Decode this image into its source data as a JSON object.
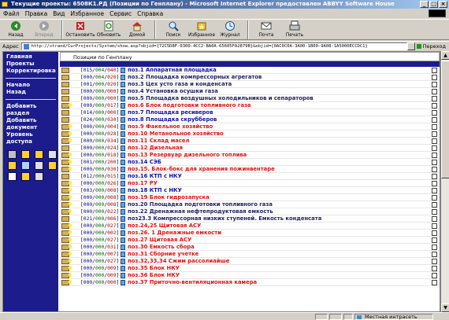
{
  "window": {
    "title": "Текущие проекты: 6508К1.РД (Позиции по Генплану) - Microsoft Internet Explorer предоставлен ABBYY Software House",
    "buttons": [
      "_",
      "□",
      "×"
    ]
  },
  "menu": [
    "Файл",
    "Правка",
    "Вид",
    "Избранное",
    "Сервис",
    "Справка"
  ],
  "toolbar": [
    {
      "label": "Назад",
      "icon": "back-arrow-icon",
      "disabled": false
    },
    {
      "label": "Вперед",
      "icon": "forward-arrow-icon",
      "disabled": true
    },
    {
      "label": "Остановить",
      "icon": "stop-icon",
      "disabled": false
    },
    {
      "label": "Обновить",
      "icon": "refresh-icon",
      "disabled": false
    },
    {
      "label": "Домой",
      "icon": "home-icon",
      "disabled": false
    },
    {
      "label": "Поиск",
      "icon": "search-icon",
      "disabled": false
    },
    {
      "label": "Избранное",
      "icon": "favorites-icon",
      "disabled": false
    },
    {
      "label": "Журнал",
      "icon": "history-icon",
      "disabled": false
    },
    {
      "label": "Почта",
      "icon": "mail-icon",
      "disabled": false
    },
    {
      "label": "Печать",
      "icon": "print-icon",
      "disabled": false
    }
  ],
  "address": {
    "label": "Адрес",
    "url": "http://strand/CurProjects/System/show.asp?objid={72C5D8F-0300-4CC2-BA0A-65605FA2879B}&objid={0AC0C0A-3A00-1B00-9A08-1A5000ECCDC1}",
    "go_label": "Переход"
  },
  "sidebar": {
    "links_top": [
      "Главная",
      "Проекты",
      "Корректировка"
    ],
    "links_mid": [
      "Начало",
      "Назад"
    ],
    "links_bottom": [
      "Добавить раздел",
      "Добавить документ",
      "Уровень доступа"
    ]
  },
  "crumb": "Позиции по Генплану",
  "rows": [
    {
      "code": [
        "015",
        "004",
        "040"
      ],
      "name": "поз.1 Аппаратная площадка",
      "color": "blue",
      "bulb": false
    },
    {
      "code": [
        "000",
        "004",
        "020"
      ],
      "name": "поз.2 Площадка компрессорных агрегатов",
      "color": "dark",
      "bulb": false
    },
    {
      "code": [
        "001",
        "000",
        "020"
      ],
      "name": "поз.3 Цех усто газа и конденсата",
      "color": "dark",
      "bulb": false
    },
    {
      "code": [
        "000",
        "000",
        "000"
      ],
      "name": "поз.4 Установка осушки газа",
      "color": "dark",
      "bulb": false
    },
    {
      "code": [
        "000",
        "000",
        "000"
      ],
      "name": "поз.5 Площадка воздушных холодильников и сепараторов",
      "color": "dark",
      "bulb": false
    },
    {
      "code": [
        "000",
        "000",
        "017"
      ],
      "name": "поз.6 Блок подготовки топливного газа",
      "color": "red",
      "bulb": true
    },
    {
      "code": [
        "014",
        "000",
        "000"
      ],
      "name": "поз.7 Площадка ресиверов",
      "color": "blue",
      "bulb": false
    },
    {
      "code": [
        "024",
        "000",
        "030"
      ],
      "name": "поз.8 Площадка скрубберов",
      "color": "blue",
      "bulb": false
    },
    {
      "code": [
        "000",
        "000",
        "004"
      ],
      "name": "поз.9 Факельное хозяйство",
      "color": "red",
      "bulb": true
    },
    {
      "code": [
        "000",
        "000",
        "028"
      ],
      "name": "поз.10 Метанольное хозяйство",
      "color": "red",
      "bulb": true
    },
    {
      "code": [
        "000",
        "000",
        "034"
      ],
      "name": "поз.11 Склад масел",
      "color": "red",
      "bulb": true
    },
    {
      "code": [
        "000",
        "000",
        "024"
      ],
      "name": "поз.12 Дизельная",
      "color": "red",
      "bulb": false
    },
    {
      "code": [
        "000",
        "000",
        "018"
      ],
      "name": "поз.13 Резервуар дизельного топлива",
      "color": "red",
      "bulb": true
    },
    {
      "code": [
        "001",
        "000",
        "200"
      ],
      "name": "поз.14 СЭБ",
      "color": "blue",
      "bulb": true
    },
    {
      "code": [
        "000",
        "000",
        "030"
      ],
      "name": "поз.15. Блок-бокс для хранения пожинвентаре",
      "color": "red",
      "bulb": true
    },
    {
      "code": [
        "012",
        "000",
        "015"
      ],
      "name": "поз.16 КТП с НКУ",
      "color": "blue",
      "bulb": false
    },
    {
      "code": [
        "000",
        "000",
        "026"
      ],
      "name": "поз.17 РУ",
      "color": "red",
      "bulb": true
    },
    {
      "code": [
        "003",
        "000",
        "008"
      ],
      "name": "поз.18 КТП с НКУ",
      "color": "blue",
      "bulb": true
    },
    {
      "code": [
        "000",
        "000",
        "008"
      ],
      "name": "поз.19 Блок гидрозапуска",
      "color": "red",
      "bulb": true
    },
    {
      "code": [
        "000",
        "000",
        "008"
      ],
      "name": "поз.20 Площадка подготовки топливного газа",
      "color": "dark",
      "bulb": true
    },
    {
      "code": [
        "000",
        "000",
        "022"
      ],
      "name": "поз.22 Дренажная нефтепродуктовая емкость",
      "color": "dark",
      "bulb": true
    },
    {
      "code": [
        "021",
        "000",
        "006"
      ],
      "name": "поз23.3 Компрессорная низких ступеней. Емкость конденсата",
      "color": "dark",
      "bulb": false
    },
    {
      "code": [
        "000",
        "000",
        "027"
      ],
      "name": "поз.24,25 Щитовая АСУ",
      "color": "red",
      "bulb": true
    },
    {
      "code": [
        "000",
        "000",
        "002"
      ],
      "name": "поз.26. 1 Дренажные емкости",
      "color": "red",
      "bulb": true
    },
    {
      "code": [
        "000",
        "000",
        "027"
      ],
      "name": "поз.27 Щитовая АСУ",
      "color": "red",
      "bulb": true
    },
    {
      "code": [
        "000",
        "000",
        "031"
      ],
      "name": "поз.30 Емкость сбора",
      "color": "red",
      "bulb": true
    },
    {
      "code": [
        "000",
        "000",
        "007"
      ],
      "name": "поз.31 Сборние учетке",
      "color": "red",
      "bulb": true
    },
    {
      "code": [
        "000",
        "000",
        "027"
      ],
      "name": "поз.32,33,34 Сжим рассолиайше",
      "color": "red",
      "bulb": true
    },
    {
      "code": [
        "000",
        "000",
        "009"
      ],
      "name": "поз.35 Блок НКУ",
      "color": "red",
      "bulb": true
    },
    {
      "code": [
        "000",
        "000",
        "009"
      ],
      "name": "поз.36 Блок НКУ",
      "color": "red",
      "bulb": true
    },
    {
      "code": [
        "000",
        "000",
        "000"
      ],
      "name": "поз.37 Приточно-вентиляционная камера",
      "color": "red",
      "bulb": true
    }
  ],
  "status": {
    "text": "",
    "zone": "Местная интрасеть"
  }
}
